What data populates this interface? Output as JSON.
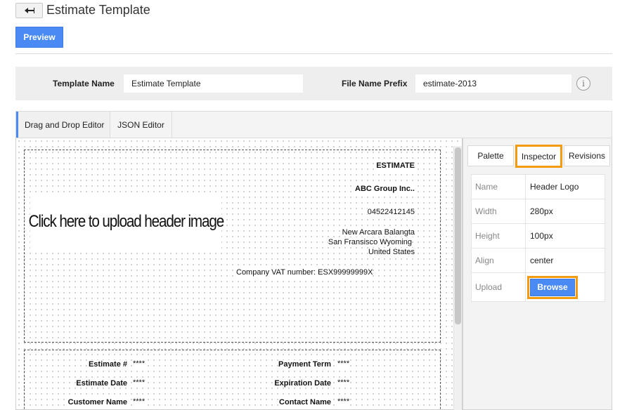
{
  "header": {
    "title": "Estimate Template",
    "back_icon": "back-arrow-icon"
  },
  "toolbar": {
    "preview_label": "Preview"
  },
  "settings": {
    "template_name_label": "Template Name",
    "template_name_value": "Estimate Template",
    "file_prefix_label": "File Name Prefix",
    "file_prefix_value": "estimate-2013",
    "info_glyph": "i"
  },
  "editor_tabs": [
    {
      "label": "Drag and Drop Editor",
      "active": true
    },
    {
      "label": "JSON Editor",
      "active": false
    }
  ],
  "canvas": {
    "upload_prompt": "Click here to upload header image",
    "doc_title": "ESTIMATE",
    "company_name": "ABC Group Inc..",
    "phone": "04522412145",
    "address_line1": "New Arcara Balangta",
    "address_line2": "San Fransisco  Wyoming",
    "address_line3": "United States",
    "vat": "Company VAT number: ESX99999999X",
    "fields_left": [
      {
        "label": "Estimate #",
        "value": "****"
      },
      {
        "label": "Estimate Date",
        "value": "****"
      },
      {
        "label": "Customer Name",
        "value": "****"
      }
    ],
    "fields_right": [
      {
        "label": "Payment Term",
        "value": "****"
      },
      {
        "label": "Expiration Date",
        "value": "****"
      },
      {
        "label": "Contact Name",
        "value": "****"
      }
    ]
  },
  "panel": {
    "tabs": [
      {
        "label": "Palette",
        "selected": false
      },
      {
        "label": "Inspector",
        "selected": true
      },
      {
        "label": "Revisions",
        "selected": false
      }
    ],
    "properties": [
      {
        "key": "Name",
        "value": "Header Logo"
      },
      {
        "key": "Width",
        "value": "280px"
      },
      {
        "key": "Height",
        "value": "100px"
      },
      {
        "key": "Align",
        "value": "center"
      }
    ],
    "upload_label": "Upload",
    "browse_label": "Browse"
  },
  "colors": {
    "accent": "#4a8af4",
    "highlight": "#f39c12"
  }
}
